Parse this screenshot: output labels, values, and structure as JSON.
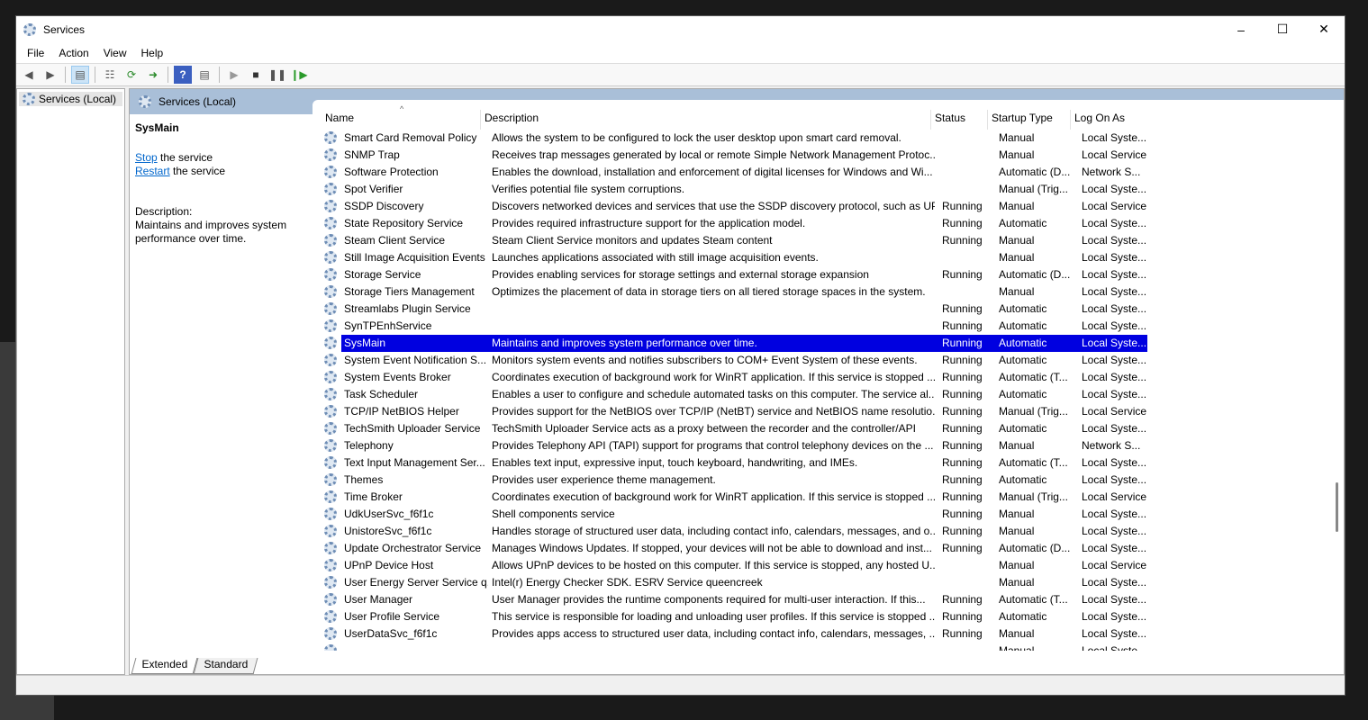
{
  "window": {
    "title": "Services"
  },
  "menu": [
    "File",
    "Action",
    "View",
    "Help"
  ],
  "tree": {
    "root": "Services (Local)"
  },
  "panel": {
    "header": "Services (Local)",
    "selected_name": "SysMain",
    "stop_link": "Stop",
    "stop_suffix": " the service",
    "restart_link": "Restart",
    "restart_suffix": " the service",
    "description_label": "Description:",
    "description": "Maintains and improves system performance over time."
  },
  "columns": {
    "name": "Name",
    "description": "Description",
    "status": "Status",
    "startup": "Startup Type",
    "logon": "Log On As"
  },
  "rows": [
    [
      "Smart Card Removal Policy",
      "Allows the system to be configured to lock the user desktop upon smart card removal.",
      "",
      "Manual",
      "Local Syste..."
    ],
    [
      "SNMP Trap",
      "Receives trap messages generated by local or remote Simple Network Management Protoc...",
      "",
      "Manual",
      "Local Service"
    ],
    [
      "Software Protection",
      "Enables the download, installation and enforcement of digital licenses for Windows and Wi...",
      "",
      "Automatic (D...",
      "Network S..."
    ],
    [
      "Spot Verifier",
      "Verifies potential file system corruptions.",
      "",
      "Manual (Trig...",
      "Local Syste..."
    ],
    [
      "SSDP Discovery",
      "Discovers networked devices and services that use the SSDP discovery protocol, such as UP...",
      "Running",
      "Manual",
      "Local Service"
    ],
    [
      "State Repository Service",
      "Provides required infrastructure support for the application model.",
      "Running",
      "Automatic",
      "Local Syste..."
    ],
    [
      "Steam Client Service",
      "Steam Client Service monitors and updates Steam content",
      "Running",
      "Manual",
      "Local Syste..."
    ],
    [
      "Still Image Acquisition Events",
      "Launches applications associated with still image acquisition events.",
      "",
      "Manual",
      "Local Syste..."
    ],
    [
      "Storage Service",
      "Provides enabling services for storage settings and external storage expansion",
      "Running",
      "Automatic (D...",
      "Local Syste..."
    ],
    [
      "Storage Tiers Management",
      "Optimizes the placement of data in storage tiers on all tiered storage spaces in the system.",
      "",
      "Manual",
      "Local Syste..."
    ],
    [
      "Streamlabs Plugin Service",
      "",
      "Running",
      "Automatic",
      "Local Syste..."
    ],
    [
      "SynTPEnhService",
      "",
      "Running",
      "Automatic",
      "Local Syste..."
    ],
    [
      "SysMain",
      "Maintains and improves system performance over time.",
      "Running",
      "Automatic",
      "Local Syste..."
    ],
    [
      "System Event Notification S...",
      "Monitors system events and notifies subscribers to COM+ Event System of these events.",
      "Running",
      "Automatic",
      "Local Syste..."
    ],
    [
      "System Events Broker",
      "Coordinates execution of background work for WinRT application. If this service is stopped ...",
      "Running",
      "Automatic (T...",
      "Local Syste..."
    ],
    [
      "Task Scheduler",
      "Enables a user to configure and schedule automated tasks on this computer. The service al...",
      "Running",
      "Automatic",
      "Local Syste..."
    ],
    [
      "TCP/IP NetBIOS Helper",
      "Provides support for the NetBIOS over TCP/IP (NetBT) service and NetBIOS name resolutio...",
      "Running",
      "Manual (Trig...",
      "Local Service"
    ],
    [
      "TechSmith Uploader Service",
      "TechSmith Uploader Service acts as a proxy between the recorder and the controller/API",
      "Running",
      "Automatic",
      "Local Syste..."
    ],
    [
      "Telephony",
      "Provides Telephony API (TAPI) support for programs that control telephony devices on the ...",
      "Running",
      "Manual",
      "Network S..."
    ],
    [
      "Text Input Management Ser...",
      "Enables text input, expressive input, touch keyboard, handwriting, and IMEs.",
      "Running",
      "Automatic (T...",
      "Local Syste..."
    ],
    [
      "Themes",
      "Provides user experience theme management.",
      "Running",
      "Automatic",
      "Local Syste..."
    ],
    [
      "Time Broker",
      "Coordinates execution of background work for WinRT application. If this service is stopped ...",
      "Running",
      "Manual (Trig...",
      "Local Service"
    ],
    [
      "UdkUserSvc_f6f1c",
      "Shell components service",
      "Running",
      "Manual",
      "Local Syste..."
    ],
    [
      "UnistoreSvc_f6f1c",
      "Handles storage of structured user data, including contact info, calendars, messages, and o...",
      "Running",
      "Manual",
      "Local Syste..."
    ],
    [
      "Update Orchestrator Service",
      "Manages Windows Updates. If stopped, your devices will not be able to download and inst...",
      "Running",
      "Automatic (D...",
      "Local Syste..."
    ],
    [
      "UPnP Device Host",
      "Allows UPnP devices to be hosted on this computer. If this service is stopped, any hosted U...",
      "",
      "Manual",
      "Local Service"
    ],
    [
      "User Energy Server Service q...",
      "Intel(r) Energy Checker SDK. ESRV Service queencreek",
      "",
      "Manual",
      "Local Syste..."
    ],
    [
      "User Manager",
      "User Manager provides the runtime components required for multi-user interaction.  If this...",
      "Running",
      "Automatic (T...",
      "Local Syste..."
    ],
    [
      "User Profile Service",
      "This service is responsible for loading and unloading user profiles. If this service is stopped ...",
      "Running",
      "Automatic",
      "Local Syste..."
    ],
    [
      "UserDataSvc_f6f1c",
      "Provides apps access to structured user data, including contact info, calendars, messages, ...",
      "Running",
      "Manual",
      "Local Syste..."
    ],
    [
      "",
      "",
      "",
      "Manual",
      "Local Syste..."
    ]
  ],
  "selected_index": 12,
  "tabs": [
    "Extended",
    "Standard"
  ],
  "colors": {
    "selection": "#0000e0",
    "band": "#a9bfd8",
    "link": "#0066cc"
  }
}
